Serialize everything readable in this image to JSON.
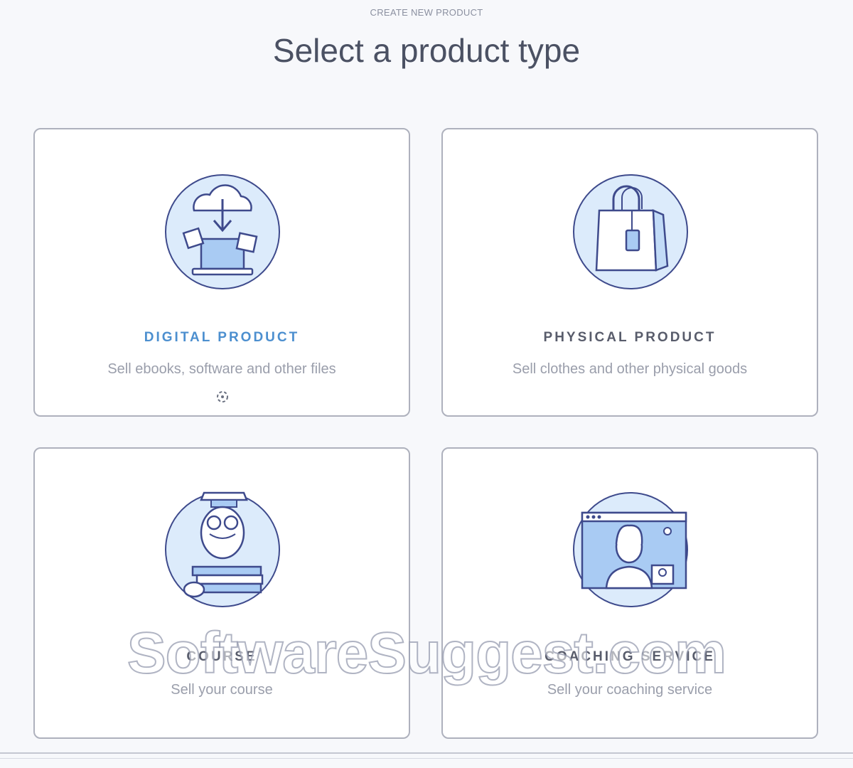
{
  "header": {
    "eyebrow": "CREATE NEW PRODUCT",
    "title": "Select a product type"
  },
  "cards": [
    {
      "title": "DIGITAL PRODUCT",
      "description": "Sell ebooks, software and other files",
      "icon": "cloud-download-laptop-icon"
    },
    {
      "title": "PHYSICAL PRODUCT",
      "description": "Sell clothes and other physical goods",
      "icon": "shopping-bag-icon"
    },
    {
      "title": "COURSE",
      "description": "Sell your course",
      "icon": "owl-books-icon"
    },
    {
      "title": "COACHING SERVICE",
      "description": "Sell your coaching service",
      "icon": "video-call-icon"
    }
  ],
  "watermark": "SoftwareSuggest.com",
  "colors": {
    "accent": "#4c8fcf",
    "illustration_fill": "#dcebfb",
    "illustration_stroke": "#3e4a8c",
    "card_border": "#aeb1bd",
    "background": "#f7f8fb"
  }
}
